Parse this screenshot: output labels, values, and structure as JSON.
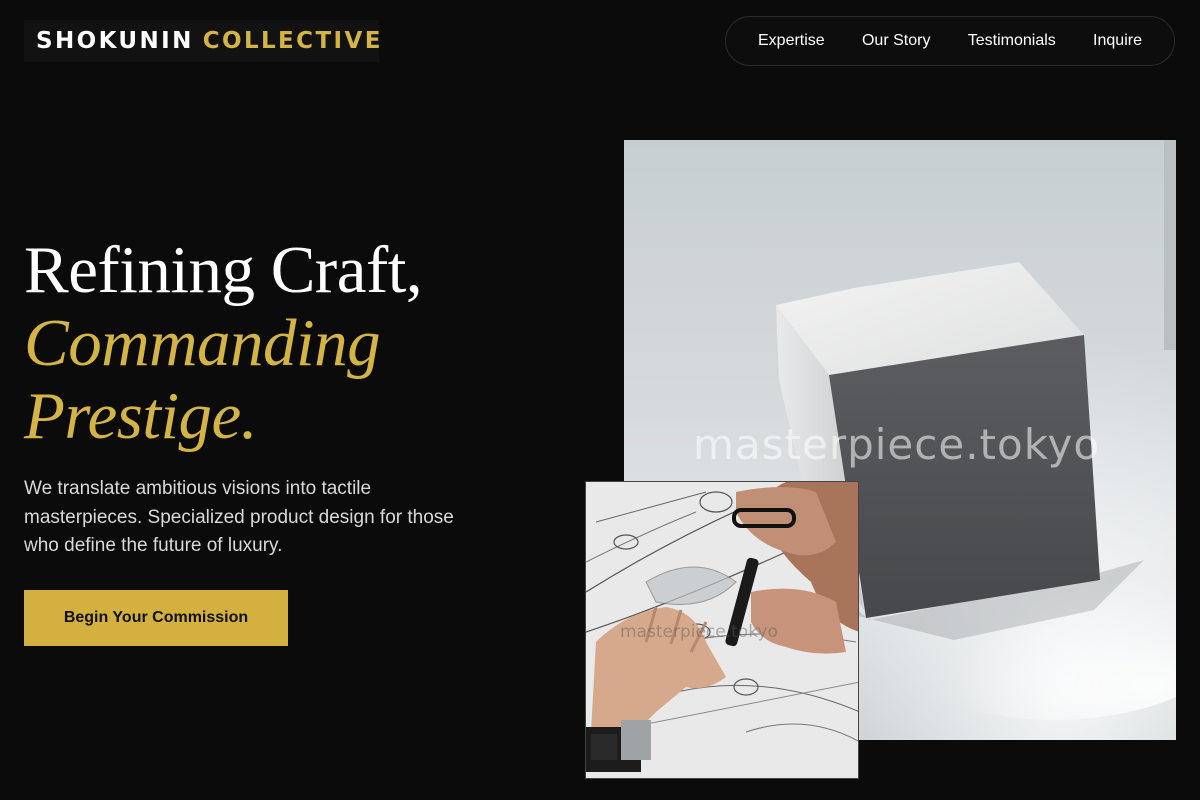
{
  "brand": {
    "name_part1": "SHOKUNIN",
    "name_part2": "COLLECTIVE"
  },
  "nav": {
    "items": [
      {
        "label": "Expertise"
      },
      {
        "label": "Our Story"
      },
      {
        "label": "Testimonials"
      },
      {
        "label": "Inquire"
      }
    ]
  },
  "hero": {
    "headline_line1": "Refining Craft,",
    "headline_line2": "Commanding",
    "headline_line3": "Prestige.",
    "subcopy": "We translate ambitious visions into tactile masterpieces. Specialized product design for those who define the future of luxury.",
    "cta_label": "Begin Your Commission"
  },
  "images": {
    "watermark": "masterpiece.tokyo"
  },
  "colors": {
    "background": "#0b0b0b",
    "accent_gold": "#d4b445",
    "cta_background": "#d4b13f",
    "text_primary": "#ffffff"
  }
}
